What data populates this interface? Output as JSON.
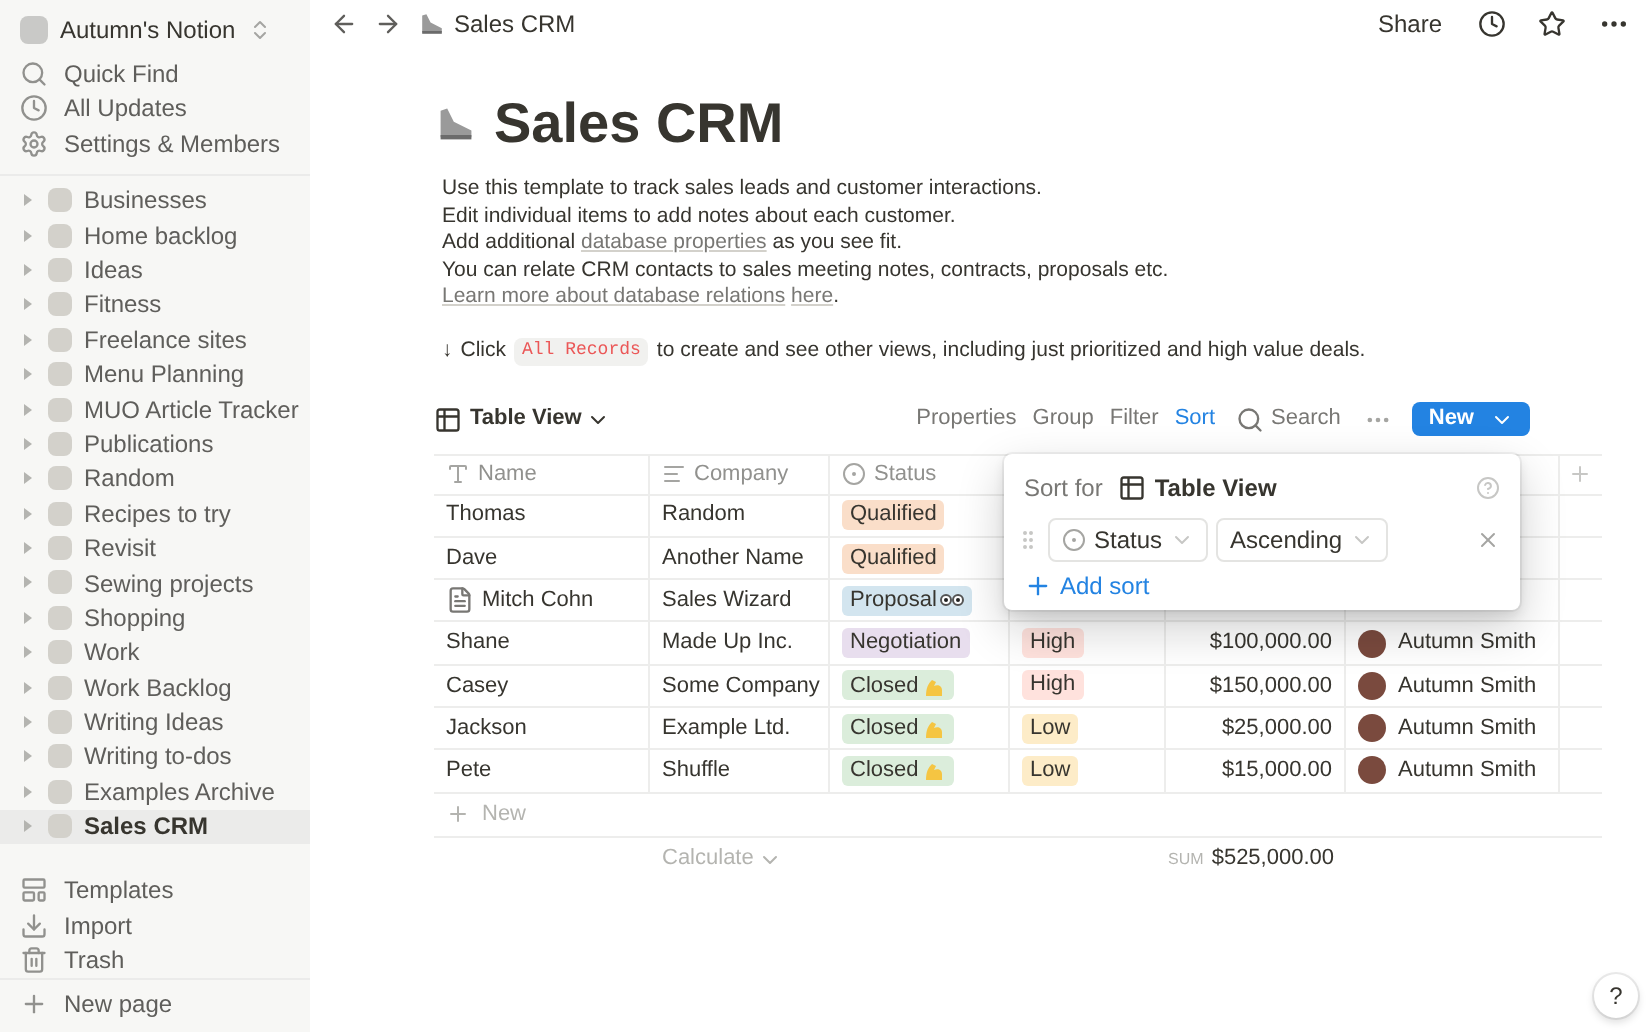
{
  "sidebar": {
    "workspace": "Autumn's Notion",
    "top_items": [
      {
        "kind": "search",
        "label": "Quick Find"
      },
      {
        "kind": "updates",
        "label": "All Updates"
      },
      {
        "kind": "settings",
        "label": "Settings & Members"
      }
    ],
    "pages": [
      {
        "label": "Businesses",
        "selected": false
      },
      {
        "label": "Home backlog",
        "selected": false
      },
      {
        "label": "Ideas",
        "selected": false
      },
      {
        "label": "Fitness",
        "selected": false
      },
      {
        "label": "Freelance sites",
        "selected": false
      },
      {
        "label": "Menu Planning",
        "selected": false
      },
      {
        "label": "MUO Article Tracker",
        "selected": false
      },
      {
        "label": "Publications",
        "selected": false
      },
      {
        "label": "Random",
        "selected": false
      },
      {
        "label": "Recipes to try",
        "selected": false
      },
      {
        "label": "Revisit",
        "selected": false
      },
      {
        "label": "Sewing projects",
        "selected": false
      },
      {
        "label": "Shopping",
        "selected": false
      },
      {
        "label": "Work",
        "selected": false
      },
      {
        "label": "Work Backlog",
        "selected": false
      },
      {
        "label": "Writing Ideas",
        "selected": false
      },
      {
        "label": "Writing to-dos",
        "selected": false
      },
      {
        "label": "Examples Archive",
        "selected": false
      },
      {
        "label": "Sales CRM",
        "selected": true
      }
    ],
    "bottom_items": [
      {
        "kind": "templates",
        "label": "Templates"
      },
      {
        "kind": "import",
        "label": "Import"
      },
      {
        "kind": "trash",
        "label": "Trash"
      }
    ],
    "new_page": "New page"
  },
  "topbar": {
    "breadcrumb": "Sales CRM",
    "share": "Share"
  },
  "page": {
    "title": "Sales CRM",
    "description": [
      "Use this template to track sales leads and customer interactions.",
      "Edit individual items to add notes about each customer."
    ],
    "line3": {
      "before": "Add additional ",
      "link": "database properties",
      "after": " as you see fit."
    },
    "line4": {
      "text": "You can relate CRM contacts to sales meeting notes, contracts, proposals etc. ",
      "link1": "Learn more about database relations",
      "link2": "here",
      "after": "."
    },
    "hint": {
      "arrow": "↓",
      "before": "Click",
      "code": "All Records",
      "after": "to create and see other views, including just prioritized and high value deals."
    }
  },
  "database": {
    "view": "Table View",
    "toolbar": [
      {
        "label": "Properties",
        "selected": false
      },
      {
        "label": "Group",
        "selected": false
      },
      {
        "label": "Filter",
        "selected": false
      },
      {
        "label": "Sort",
        "selected": true
      }
    ],
    "search": "Search",
    "new": "New",
    "columns": [
      {
        "kind": "title",
        "label": "Name"
      },
      {
        "kind": "text",
        "label": "Company"
      },
      {
        "kind": "select",
        "label": "Status"
      }
    ],
    "rows": [
      {
        "name": "Thomas",
        "company": "Random",
        "status": {
          "label": "Qualified",
          "kind": "plain",
          "color": "#fadec9"
        }
      },
      {
        "name": "Dave",
        "company": "Another Name",
        "status": {
          "label": "Qualified",
          "kind": "plain",
          "color": "#fadec9"
        }
      },
      {
        "name": "Mitch Cohn",
        "has_page": true,
        "company": "Sales Wizard",
        "status": {
          "label": "Proposal",
          "kind": "eyes",
          "color": "#d3e5ef"
        }
      },
      {
        "name": "Shane",
        "company": "Made Up Inc.",
        "status": {
          "label": "Negotiation",
          "kind": "plain",
          "color": "#e8deee"
        },
        "priority": {
          "label": "High",
          "color": "#ffe2dd"
        },
        "value": "$100,000.00",
        "owner": "Autumn Smith"
      },
      {
        "name": "Casey",
        "company": "Some Company",
        "status": {
          "label": "Closed",
          "kind": "arm",
          "color": "#dbeddb"
        },
        "priority": {
          "label": "High",
          "color": "#ffe2dd"
        },
        "value": "$150,000.00",
        "owner": "Autumn Smith"
      },
      {
        "name": "Jackson",
        "company": "Example Ltd.",
        "status": {
          "label": "Closed",
          "kind": "arm",
          "color": "#dbeddb"
        },
        "priority": {
          "label": "Low",
          "color": "#fdecc8"
        },
        "value": "$25,000.00",
        "owner": "Autumn Smith"
      },
      {
        "name": "Pete",
        "company": "Shuffle",
        "status": {
          "label": "Closed",
          "kind": "arm",
          "color": "#dbeddb"
        },
        "priority": {
          "label": "Low",
          "color": "#fdecc8"
        },
        "value": "$15,000.00",
        "owner": "Autumn Smith"
      }
    ],
    "new_row": "New",
    "calculate": "Calculate",
    "sum_label": "SUM",
    "sum": "$525,000.00",
    "sort_popover": {
      "title": "Sort for",
      "view": "Table View",
      "property": "Status",
      "direction": "Ascending",
      "add": "Add sort"
    }
  },
  "help": "?"
}
